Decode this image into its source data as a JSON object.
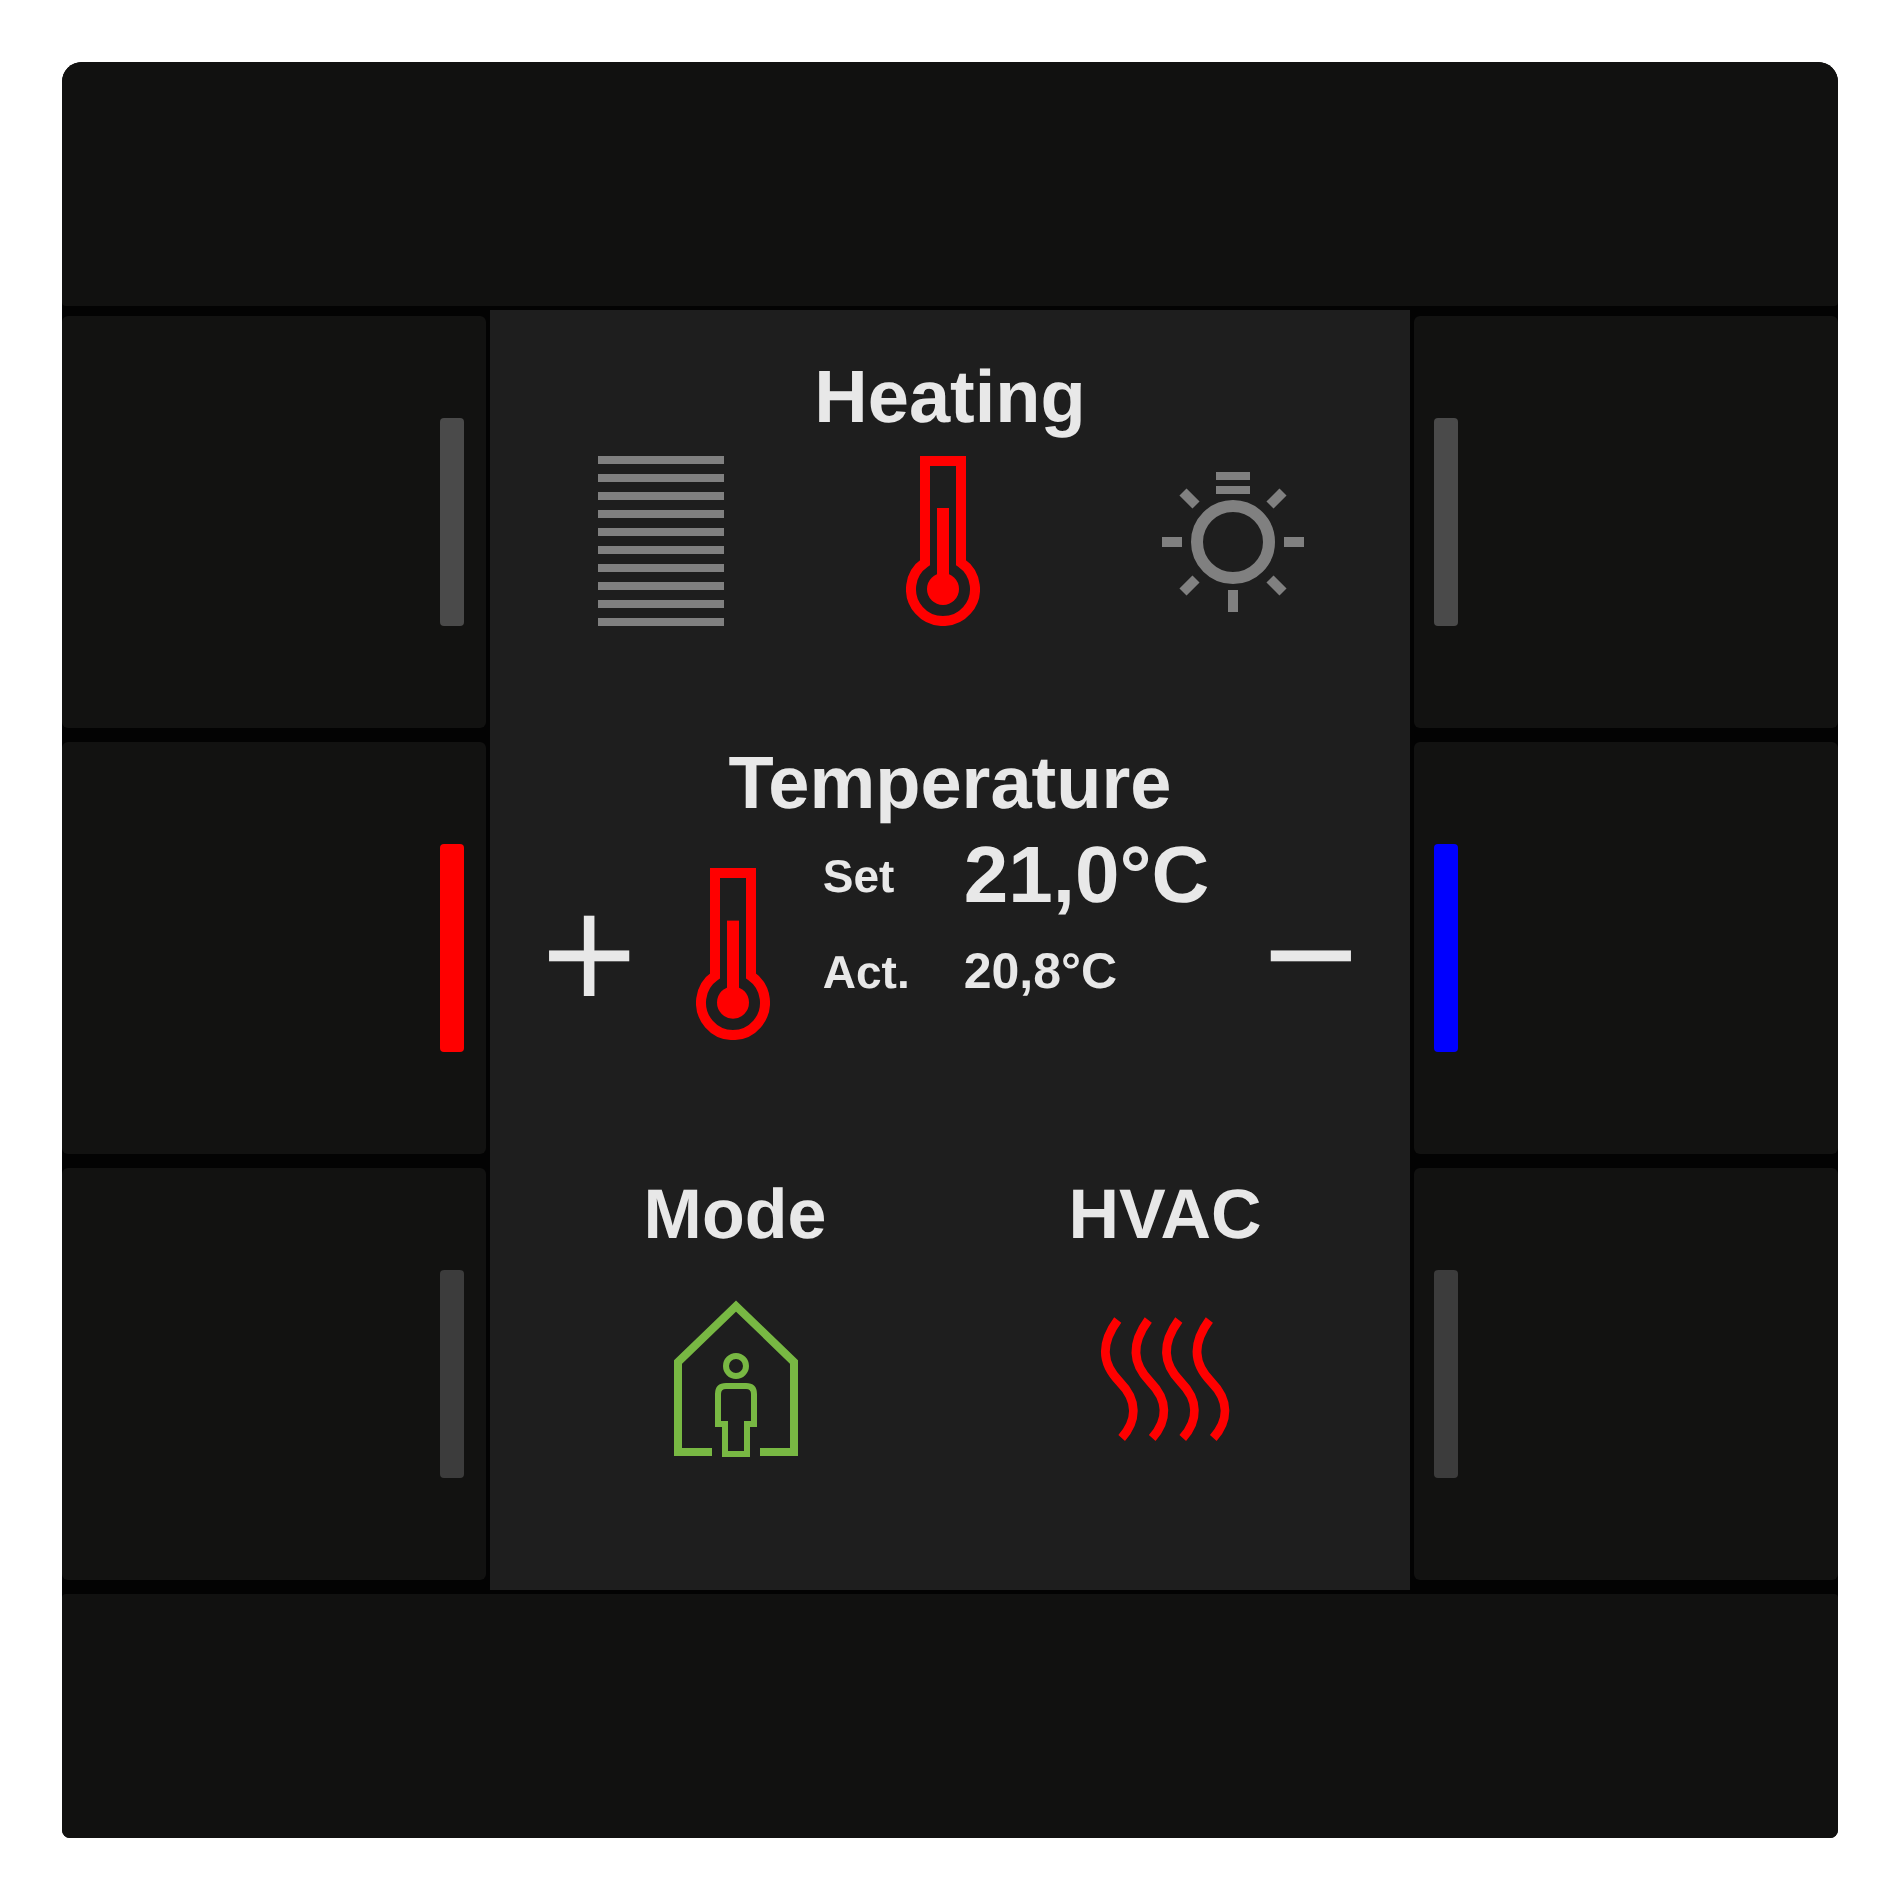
{
  "keys_left": [
    {
      "color": "#4a4a4a"
    },
    {
      "color": "#ff0000"
    },
    {
      "color": "#3c3c3c"
    }
  ],
  "keys_right": [
    {
      "color": "#4a4a4a"
    },
    {
      "color": "#0000ff"
    },
    {
      "color": "#3c3c3c"
    }
  ],
  "display": {
    "header": {
      "title": "Heating",
      "functions": [
        {
          "kind": "blinds",
          "selected": false
        },
        {
          "kind": "heating",
          "selected": true
        },
        {
          "kind": "lighting",
          "selected": false
        }
      ]
    },
    "temperature": {
      "title": "Temperature",
      "increase": "+",
      "decrease": "−",
      "set_label": "Set",
      "set_value": "21,0°C",
      "actual_label": "Act.",
      "actual_value": "20,8°C"
    },
    "tiles": [
      {
        "label": "Mode",
        "kind": "presence",
        "color": "#78b843"
      },
      {
        "label": "HVAC",
        "kind": "heat",
        "color": "#ff0000"
      }
    ]
  }
}
